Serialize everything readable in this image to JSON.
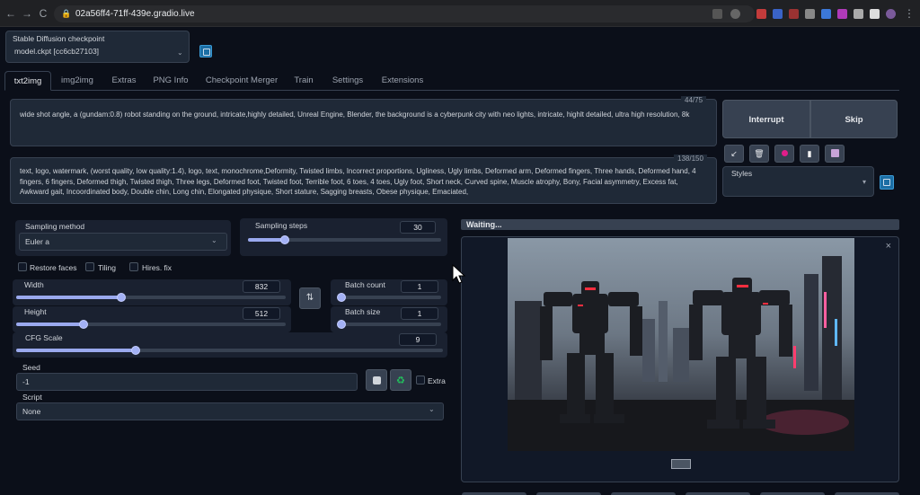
{
  "browser": {
    "url": "02a56ff4-71ff-439e.gradio.live",
    "back": "←",
    "forward": "→",
    "reload": "C",
    "menu": "⋮"
  },
  "checkpoint": {
    "label": "Stable Diffusion checkpoint",
    "value": "model.ckpt [cc6cb27103]"
  },
  "tabs": [
    "txt2img",
    "img2img",
    "Extras",
    "PNG Info",
    "Checkpoint Merger",
    "Train",
    "Settings",
    "Extensions"
  ],
  "prompt": {
    "counter": "44/75",
    "text": "wide shot angle, a (gundam:0.8) robot standing on the ground, intricate,highly detailed, Unreal Engine, Blender, the background is a cyberpunk city with neo lights, intricate, highlt detailed, ultra high resolution, 8k"
  },
  "negative_prompt": {
    "counter": "138/150",
    "text": "text, logo, watermark, (worst quality, low quality:1.4), logo, text, monochrome,Deformity, Twisted limbs, Incorrect proportions, Ugliness, Ugly limbs, Deformed arm, Deformed fingers, Three hands, Deformed hand, 4 fingers, 6 fingers, Deformed thigh, Twisted thigh, Three legs, Deformed foot, Twisted foot, Terrible foot, 6 toes, 4 toes, Ugly foot, Short neck, Curved spine, Muscle atrophy, Bony, Facial asymmetry, Excess fat, Awkward gait, Incoordinated body, Double chin, Long chin, Elongated physique, Short stature, Sagging breasts, Obese physique, Emaciated,"
  },
  "buttons": {
    "interrupt": "Interrupt",
    "skip": "Skip",
    "swap": "⇅"
  },
  "styles": {
    "label": "Styles",
    "value": ""
  },
  "sampling": {
    "method_label": "Sampling method",
    "method_value": "Euler a",
    "steps_label": "Sampling steps",
    "steps_value": "30",
    "steps_fraction": 0.19
  },
  "options": {
    "restore_faces": "Restore faces",
    "tiling": "Tiling",
    "hires_fix": "Hires. fix"
  },
  "width": {
    "label": "Width",
    "value": "832"
  },
  "height": {
    "label": "Height",
    "value": "512"
  },
  "batch_count": {
    "label": "Batch count",
    "value": "1"
  },
  "batch_size": {
    "label": "Batch size",
    "value": "1"
  },
  "cfg": {
    "label": "CFG Scale",
    "value": "9"
  },
  "seed": {
    "label": "Seed",
    "value": "-1",
    "extra": "Extra"
  },
  "script": {
    "label": "Script",
    "value": "None"
  },
  "output": {
    "status": "Waiting...",
    "close": "×"
  },
  "colors": {
    "accent": "#9aa9ee",
    "background": "#0b0f19",
    "panel": "#1f2937"
  }
}
